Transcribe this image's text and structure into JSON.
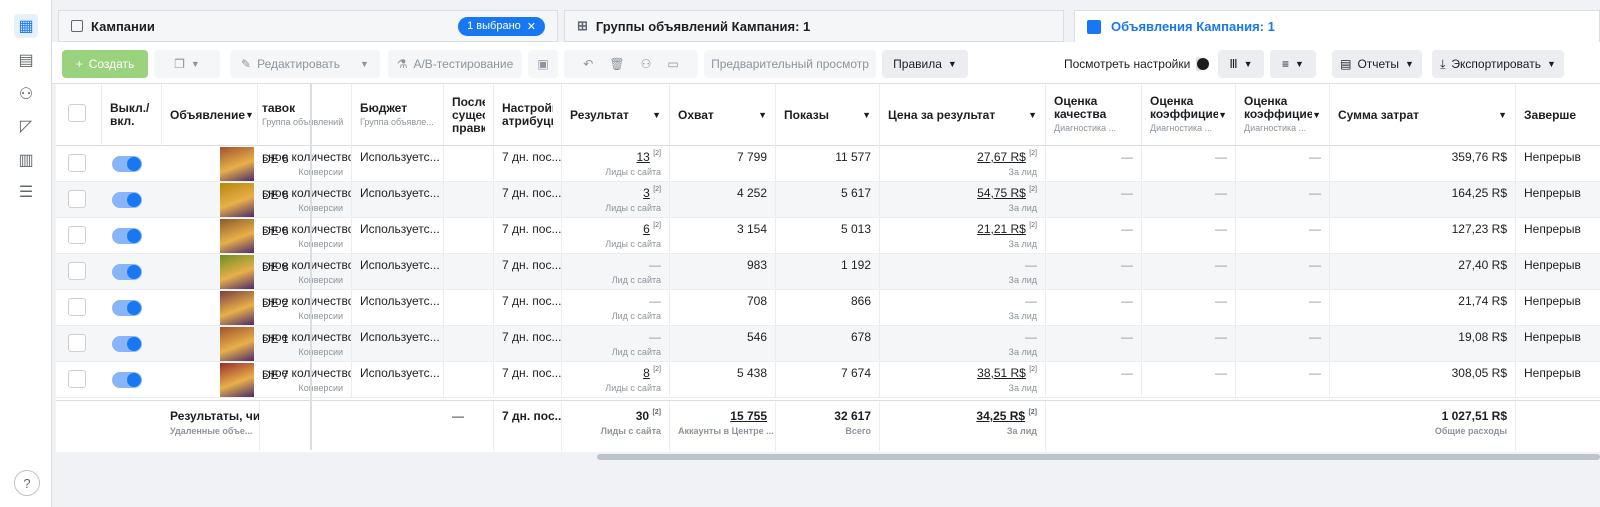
{
  "tabs": {
    "campaigns": "Кампании",
    "selected_chip": "1 выбрано",
    "adsets": "Группы объявлений Кампания: 1",
    "ads": "Объявления Кампания: 1"
  },
  "toolbar": {
    "create": "Создать",
    "edit": "Редактировать",
    "ab_test": "A/B-тестирование",
    "preview": "Предварительный просмотр",
    "rules": "Правила",
    "view_settings": "Посмотреть настройки",
    "reports": "Отчеты",
    "export": "Экспортировать"
  },
  "headers": {
    "onoff": "Выкл./ вкл.",
    "ad": "Объявление",
    "bid": "тавок",
    "bid_sub": "Группа объявлений",
    "budget": "Бюджет",
    "budget_sub": "Группа объявле...",
    "last_change": "Послед существ правка",
    "attribution": "Настройка атрибуции",
    "result": "Результат",
    "reach": "Охват",
    "impressions": "Показы",
    "cost_per_result": "Цена за результат",
    "quality": "Оценка качества",
    "quality_sub": "Диагностика ...",
    "engagement": "Оценка коэффициент вовлеченно",
    "engagement_sub": "Диагностика ...",
    "conversion": "Оценка коэффициент конверсии",
    "conversion_sub": "Диагностика ...",
    "spend": "Сумма затрат",
    "ends": "Заверше"
  },
  "rows": [
    {
      "name": "DE 6",
      "bid": "ьное количество",
      "bid_sub": "Конверсии",
      "budget": "Используетс...",
      "attr": "7 дн. пос...",
      "result": "13",
      "result_sub": "Лиды с сайта",
      "reach": "7 799",
      "impr": "11 577",
      "cpr": "27,67 R$",
      "cpr_sub": "За лид",
      "q": "—",
      "e": "—",
      "c": "—",
      "spend": "359,76 R$",
      "ends": "Непрерыв",
      "thumb": "#a0522d"
    },
    {
      "name": "DE 6",
      "bid": "ьное количество",
      "bid_sub": "Конверсии",
      "budget": "Используетс...",
      "attr": "7 дн. пос...",
      "result": "3",
      "result_sub": "Лиды с сайта",
      "reach": "4 252",
      "impr": "5 617",
      "cpr": "54,75 R$",
      "cpr_sub": "За лид",
      "q": "—",
      "e": "—",
      "c": "—",
      "spend": "164,25 R$",
      "ends": "Непрерыв",
      "thumb": "#b8860b"
    },
    {
      "name": "DE 6",
      "bid": "ьное количество",
      "bid_sub": "Конверсии",
      "budget": "Используетс...",
      "attr": "7 дн. пос...",
      "result": "6",
      "result_sub": "Лиды с сайта",
      "reach": "3 154",
      "impr": "5 013",
      "cpr": "21,21 R$",
      "cpr_sub": "За лид",
      "q": "—",
      "e": "—",
      "c": "—",
      "spend": "127,23 R$",
      "ends": "Непрерыв",
      "thumb": "#8b5a2b"
    },
    {
      "name": "DE 8",
      "bid": "ьное количество",
      "bid_sub": "Конверсии",
      "budget": "Используетс...",
      "attr": "7 дн. пос...",
      "result": "—",
      "result_sub": "Лид с сайта",
      "reach": "983",
      "impr": "1 192",
      "cpr": "—",
      "cpr_sub": "За лид",
      "q": "—",
      "e": "—",
      "c": "—",
      "spend": "27,40 R$",
      "ends": "Непрерыв",
      "thumb": "#6b8e23"
    },
    {
      "name": "DE 2",
      "bid": "ьное количество",
      "bid_sub": "Конверсии",
      "budget": "Используетс...",
      "attr": "7 дн. пос...",
      "result": "—",
      "result_sub": "Лид с сайта",
      "reach": "708",
      "impr": "866",
      "cpr": "—",
      "cpr_sub": "За лид",
      "q": "—",
      "e": "—",
      "c": "—",
      "spend": "21,74 R$",
      "ends": "Непрерыв",
      "thumb": "#7b3f3f"
    },
    {
      "name": "DE 1",
      "bid": "ьное количество",
      "bid_sub": "Конверсии",
      "budget": "Используетс...",
      "attr": "7 дн. пос...",
      "result": "—",
      "result_sub": "Лид с сайта",
      "reach": "546",
      "impr": "678",
      "cpr": "—",
      "cpr_sub": "За лид",
      "q": "—",
      "e": "—",
      "c": "—",
      "spend": "19,08 R$",
      "ends": "Непрерыв",
      "thumb": "#a0522d"
    },
    {
      "name": "DE 7",
      "bid": "ьное количество",
      "bid_sub": "Конверсии",
      "budget": "Используетс...",
      "attr": "7 дн. пос...",
      "result": "8",
      "result_sub": "Лиды с сайта",
      "reach": "5 438",
      "impr": "7 674",
      "cpr": "38,51 R$",
      "cpr_sub": "За лид",
      "q": "—",
      "e": "—",
      "c": "—",
      "spend": "308,05 R$",
      "ends": "Непрерыв",
      "thumb": "#9b2d2d"
    }
  ],
  "totals": {
    "label": "Результаты, чи",
    "label_sub": "Удаленные объе...",
    "last_change": "—",
    "attr": "7 дн. пос...",
    "result": "30",
    "result_sub": "Лиды с сайта",
    "reach": "15 755",
    "reach_sub": "Аккаунты в Центре ...",
    "impr": "32 617",
    "impr_sub": "Всего",
    "cpr": "34,25 R$",
    "cpr_sub": "За лид",
    "spend": "1 027,51 R$",
    "spend_sub": "Общие расходы"
  },
  "footnote_mark": "[2]",
  "help": "?"
}
